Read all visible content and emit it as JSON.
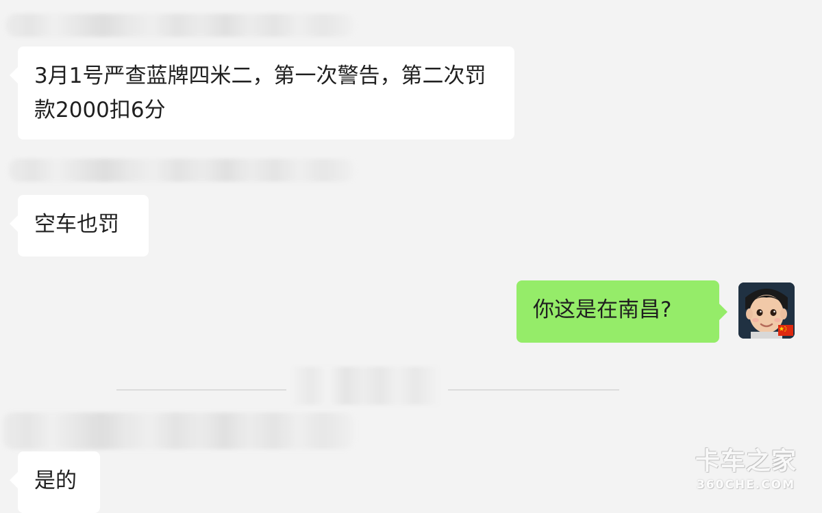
{
  "chat": {
    "messages": [
      {
        "side": "left",
        "text": "3月1号严查蓝牌四米二，第一次警告，第二次罚款2000扣6分"
      },
      {
        "side": "left",
        "text": "空车也罚"
      },
      {
        "side": "right",
        "text": "你这是在南昌?"
      },
      {
        "side": "left",
        "text": "是的"
      }
    ]
  },
  "watermark": {
    "brand": "卡车之家",
    "domain": "360CHE.COM"
  },
  "colors": {
    "background": "#f3f3f3",
    "incoming_bubble": "#ffffff",
    "outgoing_bubble": "#95ec69",
    "text": "#1f1f1f"
  },
  "icons": {
    "avatar": "child-avatar-icon",
    "flag": "china-flag-icon"
  }
}
